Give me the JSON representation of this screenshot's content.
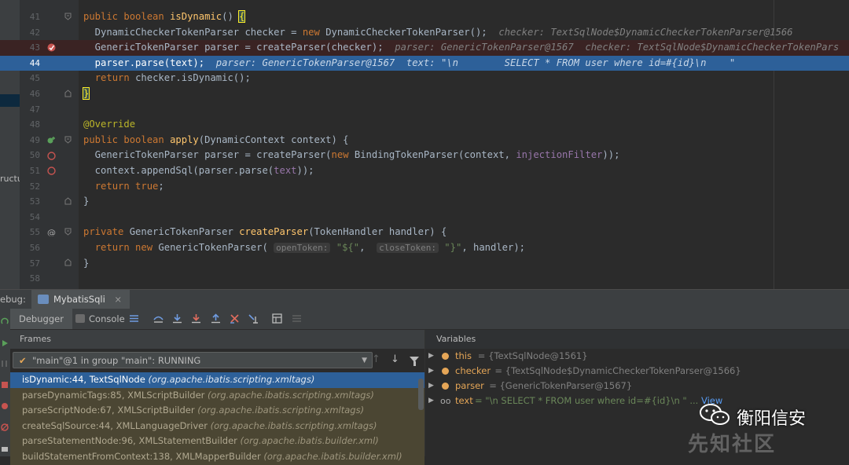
{
  "editor": {
    "lines": [
      {
        "num": "41",
        "parts": [
          [
            "kw",
            "public boolean "
          ],
          [
            "fn",
            "isDynamic"
          ],
          [
            "",
            "() "
          ],
          [
            "bracehl",
            "{"
          ]
        ]
      },
      {
        "num": "42",
        "parts": [
          [
            "",
            "  DynamicCheckerTokenParser checker = "
          ],
          [
            "kw",
            "new "
          ],
          [
            "",
            "DynamicCheckerTokenParser();  "
          ],
          [
            "hint",
            "checker: TextSqlNode$DynamicCheckerTokenParser@1566"
          ]
        ]
      },
      {
        "num": "43",
        "parts": [
          [
            "",
            "  GenericTokenParser parser = createParser(checker);  "
          ],
          [
            "hint",
            "parser: GenericTokenParser@1567  checker: TextSqlNode$DynamicCheckerTokenPars"
          ]
        ]
      },
      {
        "num": "44",
        "parts": [
          [
            "",
            "  parser.parse("
          ],
          [
            "",
            "text"
          ],
          [
            "",
            ");  "
          ],
          [
            "hint",
            "parser: GenericTokenParser@1567  text: \"\\n        SELECT * FROM user where id=#{id}\\n    \""
          ]
        ]
      },
      {
        "num": "45",
        "parts": [
          [
            "",
            "  "
          ],
          [
            "kw",
            "return "
          ],
          [
            "",
            "checker.isDynamic();"
          ]
        ]
      },
      {
        "num": "46",
        "parts": [
          [
            "bracehl",
            "}"
          ]
        ]
      },
      {
        "num": "47",
        "parts": []
      },
      {
        "num": "48",
        "parts": [
          [
            "ann",
            "@Override"
          ]
        ]
      },
      {
        "num": "49",
        "parts": [
          [
            "kw",
            "public boolean "
          ],
          [
            "fn",
            "apply"
          ],
          [
            "",
            "(DynamicContext context) {"
          ]
        ]
      },
      {
        "num": "50",
        "parts": [
          [
            "",
            "  GenericTokenParser parser = createParser("
          ],
          [
            "kw",
            "new "
          ],
          [
            "",
            "BindingTokenParser(context, "
          ],
          [
            "field",
            "injectionFilter"
          ],
          [
            "",
            "));"
          ]
        ]
      },
      {
        "num": "51",
        "parts": [
          [
            "",
            "  context.appendSql(parser.parse("
          ],
          [
            "field",
            "text"
          ],
          [
            "",
            "));"
          ]
        ]
      },
      {
        "num": "52",
        "parts": [
          [
            "",
            "  "
          ],
          [
            "kw",
            "return true"
          ],
          [
            "",
            ";"
          ]
        ]
      },
      {
        "num": "53",
        "parts": [
          [
            "",
            "}"
          ]
        ]
      },
      {
        "num": "54",
        "parts": []
      },
      {
        "num": "55",
        "parts": [
          [
            "kw",
            "private "
          ],
          [
            "",
            "GenericTokenParser "
          ],
          [
            "fn",
            "createParser"
          ],
          [
            "",
            "(TokenHandler handler) {"
          ]
        ]
      },
      {
        "num": "56",
        "parts": [
          [
            "",
            "  "
          ],
          [
            "kw",
            "return new "
          ],
          [
            "",
            "GenericTokenParser( "
          ],
          [
            "param",
            "openToken:"
          ],
          [
            "str",
            " \"${\""
          ],
          [
            "",
            ",  "
          ],
          [
            "param",
            "closeToken:"
          ],
          [
            "str",
            " \"}\""
          ],
          [
            "",
            ", handler);"
          ]
        ]
      },
      {
        "num": "57",
        "parts": [
          [
            "",
            "}"
          ]
        ]
      },
      {
        "num": "58",
        "parts": []
      }
    ],
    "structure_label": "ructu"
  },
  "debug": {
    "label": "ebug:",
    "tab_label": "MybatisSqli",
    "tab_close": "×",
    "debugger_tab": "Debugger",
    "console_tab": "Console"
  },
  "frames": {
    "header": "Frames",
    "thread": "\"main\"@1 in group \"main\": RUNNING",
    "items": [
      {
        "method": "isDynamic:44, TextSqlNode ",
        "pkg": "(org.apache.ibatis.scripting.xmltags)"
      },
      {
        "method": "parseDynamicTags:85, XMLScriptBuilder ",
        "pkg": "(org.apache.ibatis.scripting.xmltags)"
      },
      {
        "method": "parseScriptNode:67, XMLScriptBuilder ",
        "pkg": "(org.apache.ibatis.scripting.xmltags)"
      },
      {
        "method": "createSqlSource:44, XMLLanguageDriver ",
        "pkg": "(org.apache.ibatis.scripting.xmltags)"
      },
      {
        "method": "parseStatementNode:96, XMLStatementBuilder ",
        "pkg": "(org.apache.ibatis.builder.xml)"
      },
      {
        "method": "buildStatementFromContext:138, XMLMapperBuilder ",
        "pkg": "(org.apache.ibatis.builder.xml)"
      }
    ]
  },
  "variables": {
    "header": "Variables",
    "items": [
      {
        "name": "this",
        "value": " = {TextSqlNode@1561}"
      },
      {
        "name": "checker",
        "value": " = {TextSqlNode$DynamicCheckerTokenParser@1566}"
      },
      {
        "name": "parser",
        "value": " = {GenericTokenParser@1567}"
      }
    ],
    "text_var": {
      "name": "text",
      "value": " = \"\\n        SELECT * FROM user where id=#{id}\\n    \" ...",
      "view": "View"
    }
  },
  "watermark": {
    "wechat": "衡阳信安",
    "site": "先知社区"
  },
  "colors": {
    "selection": "#2d6099",
    "breakpoint": "#c75450",
    "frame_bg": "#4b4633"
  }
}
